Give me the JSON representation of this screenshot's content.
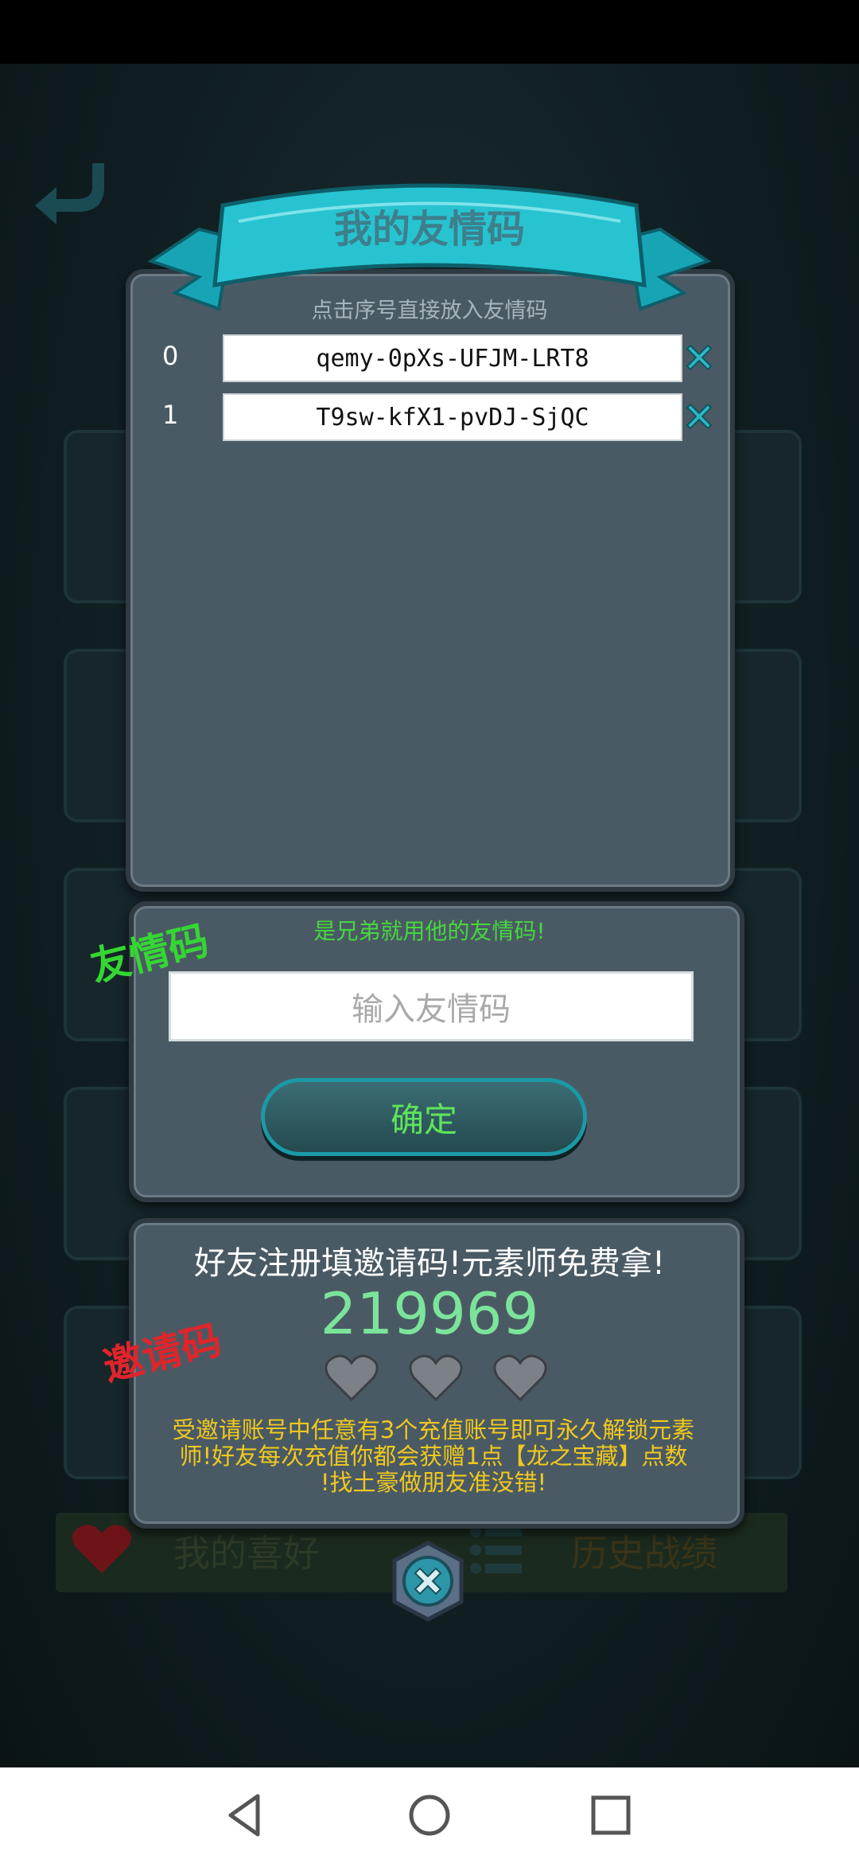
{
  "dialog": {
    "title": "我的友情码",
    "hint": "点击序号直接放入友情码",
    "codes": [
      {
        "index": "0",
        "code": "qemy-0pXs-UFJM-LRT8"
      },
      {
        "index": "1",
        "code": "T9sw-kfX1-pvDJ-SjQC"
      }
    ]
  },
  "friend_input": {
    "stamp": "友情码",
    "hint": "是兄弟就用他的友情码!",
    "placeholder": "输入友情码",
    "confirm_label": "确定"
  },
  "invite": {
    "stamp": "邀请码",
    "title": "好友注册填邀请码!元素师免费拿!",
    "code": "219969",
    "hearts": 3,
    "description_lines": [
      "受邀请账号中任意有3个充值账号即可永久解锁元素",
      "师!好友每次充值你都会获赠1点【龙之宝藏】点数",
      "!找土豪做朋友准没错!"
    ]
  },
  "background": {
    "favorites_label": "我的喜好",
    "history_label": "历史战绩"
  },
  "icons": {
    "back": "back-arrow-icon",
    "delete": "delete-x-icon",
    "heart": "heart-icon",
    "close": "close-x-icon",
    "nav_back": "nav-back-icon",
    "nav_home": "nav-home-icon",
    "nav_recent": "nav-recent-icon"
  },
  "colors": {
    "accent_teal": "#1a9aa6",
    "green_text": "#47d63f",
    "yellow_text": "#f0c81e",
    "red_stamp": "#e0242b",
    "code_green": "#7be49a"
  }
}
